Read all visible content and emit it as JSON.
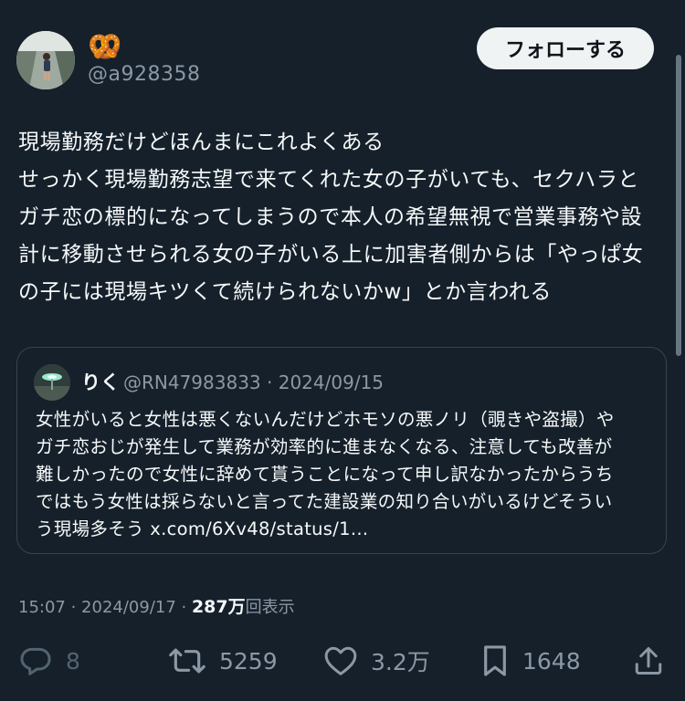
{
  "author": {
    "display_name": "🥨",
    "handle": "@a928358"
  },
  "follow_button_label": "フォローする",
  "tweet": {
    "lines": [
      "現場勤務だけどほんまにこれよくある",
      "せっかく現場勤務志望で来てくれた女の子がいても、セクハラと",
      "ガチ恋の標的になってしまうので本人の希望無視で営業事務や設",
      "計に移動させられる女の子がいる上に加害者側からは「やっぱ女",
      "の子には現場キツくて続けられないかw」とか言われる"
    ]
  },
  "quote": {
    "name": "りく",
    "meta": "@RN47983833 · 2024/09/15",
    "lines": [
      "女性がいると女性は悪くないんだけどホモソの悪ノリ（覗きや盗撮）や",
      "ガチ恋おじが発生して業務が効率的に進まなくなる、注意しても改善が",
      "難しかったので女性に辞めて貰うことになって申し訳なかったからうち",
      "ではもう女性は採らないと言ってた建設業の知り合いがいるけどそうい",
      "う現場多そう x.com/6Xv48/status/1..."
    ]
  },
  "timestamp": {
    "time_date": "15:07 · 2024/09/17 · ",
    "views_count": "287万",
    "views_label": "回表示"
  },
  "actions": {
    "reply_count": "8",
    "retweet_count": "5259",
    "like_count": "3.2万",
    "bookmark_count": "1648"
  },
  "icons": {
    "reply": "reply-icon",
    "retweet": "retweet-icon",
    "like": "heart-icon",
    "bookmark": "bookmark-icon",
    "share": "share-icon"
  },
  "colors": {
    "background": "#15202b",
    "text": "#f7f9f9",
    "secondary": "#8b98a5",
    "border": "#38444d",
    "button_bg": "#eff3f4"
  }
}
